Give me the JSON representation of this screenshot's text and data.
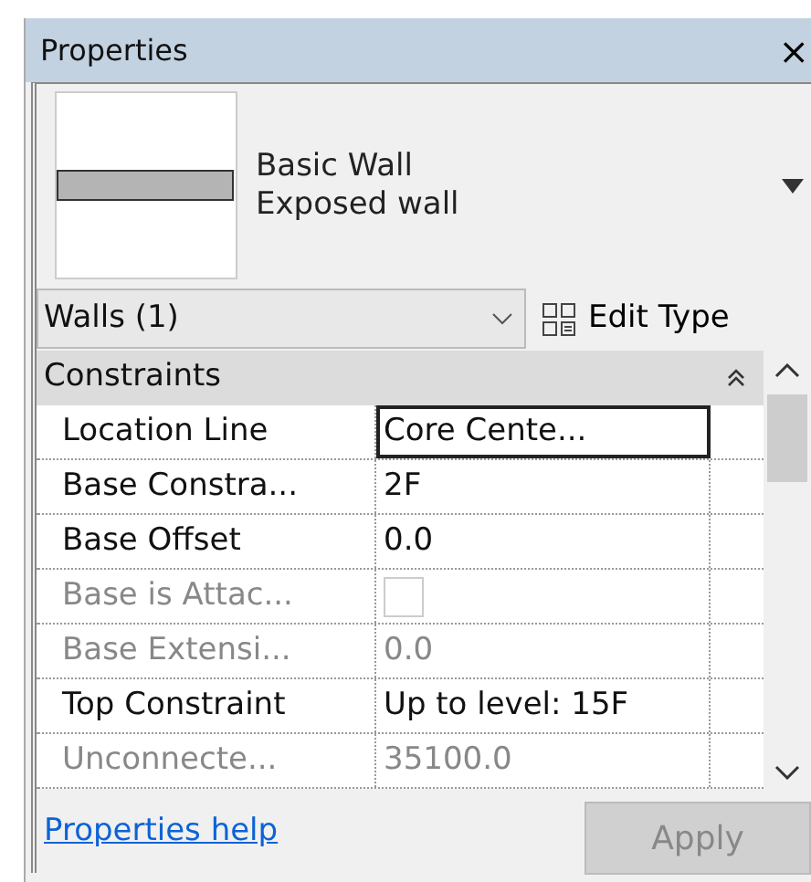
{
  "window": {
    "title": "Properties",
    "close": "×"
  },
  "type_selector": {
    "family": "Basic Wall",
    "type": "Exposed wall"
  },
  "filter": {
    "value": "Walls (1)"
  },
  "edit_type": {
    "label": "Edit Type"
  },
  "groups": [
    {
      "title": "Constraints",
      "expanded": true,
      "rows": [
        {
          "label": "Location Line",
          "kind": "text",
          "value": "Core Cente...",
          "disabled": false,
          "selected": true
        },
        {
          "label": "Base Constra...",
          "kind": "text",
          "value": "2F",
          "disabled": false,
          "selected": false
        },
        {
          "label": "Base Offset",
          "kind": "text",
          "value": "0.0",
          "disabled": false,
          "selected": false
        },
        {
          "label": "Base is Attac...",
          "kind": "checkbox",
          "checked": false,
          "disabled": true,
          "selected": false
        },
        {
          "label": "Base Extensi...",
          "kind": "text",
          "value": "0.0",
          "disabled": true,
          "selected": false
        },
        {
          "label": "Top Constraint",
          "kind": "text",
          "value": "Up to level: 15F",
          "disabled": false,
          "selected": false
        },
        {
          "label": "Unconnecte...",
          "kind": "text",
          "value": "35100.0",
          "disabled": true,
          "selected": false
        }
      ]
    }
  ],
  "footer": {
    "help_link": "Properties help",
    "apply": {
      "label": "Apply",
      "disabled": true
    }
  }
}
